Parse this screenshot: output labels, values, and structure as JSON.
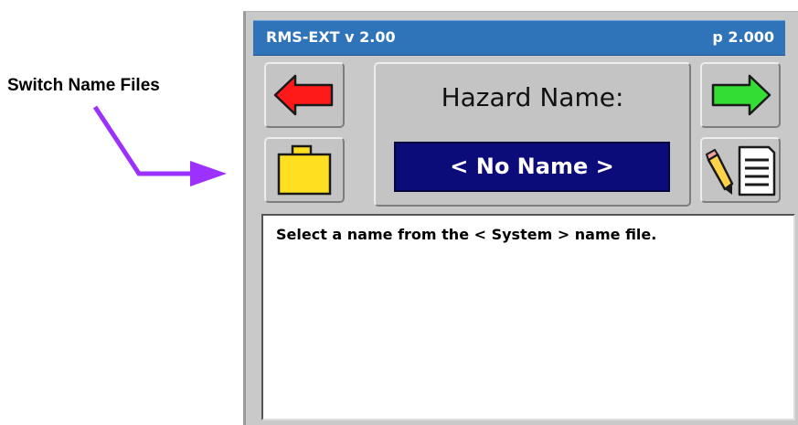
{
  "annotation": {
    "label": "Switch Name Files",
    "arrow_color": "#9b30ff"
  },
  "window": {
    "title": "RMS-EXT v 2.00",
    "page": "p 2.000",
    "title_bar_color": "#2f74b8"
  },
  "buttons": {
    "prev": {
      "icon": "red-left-arrow-icon",
      "color": "#ff1a1a"
    },
    "next": {
      "icon": "green-right-arrow-icon",
      "color": "#33dd33"
    },
    "file": {
      "icon": "yellow-folder-icon",
      "color": "#ffe020"
    },
    "edit": {
      "icon": "pencil-document-icon"
    }
  },
  "hazard": {
    "label": "Hazard Name:",
    "value": "< No Name >",
    "field_color": "#0b0b7a"
  },
  "message": {
    "text": "Select a name from the < System > name file."
  }
}
